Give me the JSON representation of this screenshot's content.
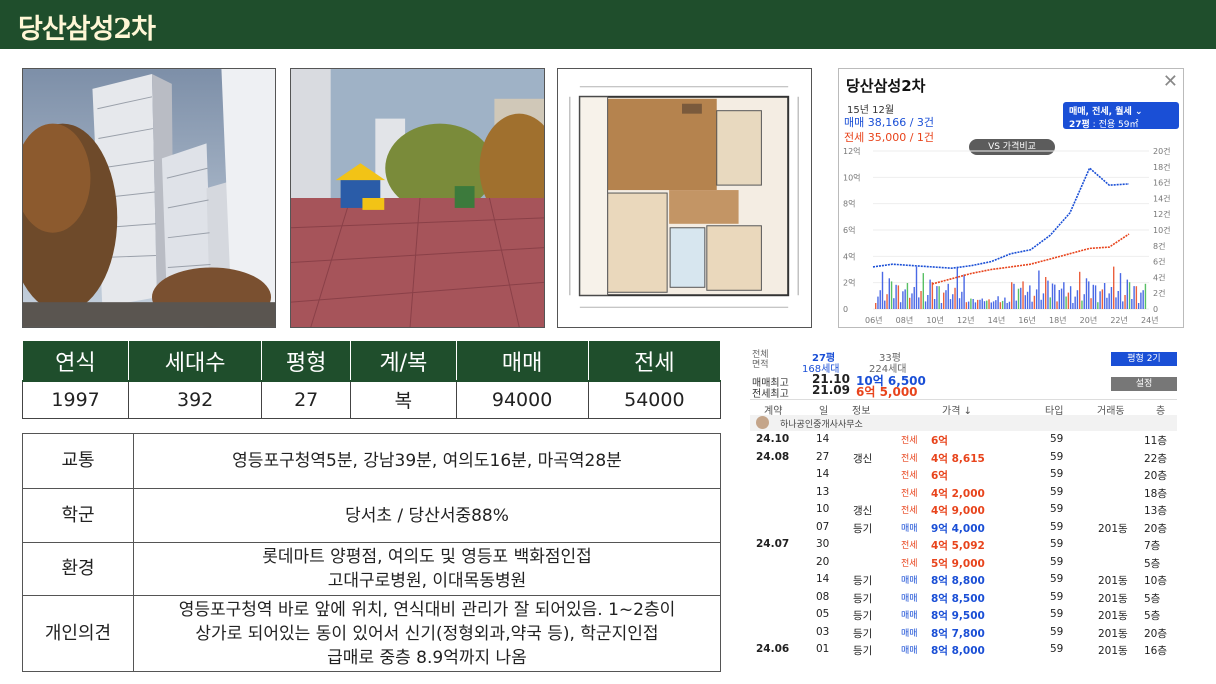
{
  "header": {
    "title": "당산삼성2차"
  },
  "basic": {
    "headers": [
      "연식",
      "세대수",
      "평형",
      "계/복",
      "매매",
      "전세"
    ],
    "values": [
      "1997",
      "392",
      "27",
      "복",
      "94000",
      "54000"
    ]
  },
  "details": [
    {
      "key": "교통",
      "lines": [
        "영등포구청역5분, 강남39분, 여의도16분, 마곡역28분"
      ]
    },
    {
      "key": "학군",
      "lines": [
        "당서초 / 당산서중88%"
      ]
    },
    {
      "key": "환경",
      "lines": [
        "롯데마트 양평점, 여의도 및 영등포 백화점인접",
        "고대구로병원, 이대목동병원"
      ]
    },
    {
      "key": "개인의견",
      "lines": [
        "영등포구청역 바로 앞에 위치, 연식대비 관리가 잘 되어있음. 1~2층이",
        "상가로 되어있는 동이 있어서 신기(정형외과,약국 등), 학군지인접",
        "급매로 중층 8.9억까지 나옴"
      ]
    }
  ],
  "chart": {
    "title": "당산삼성2차",
    "period": "15년 12월",
    "sale": "매매 38,166 / 3건",
    "rent": "전세 35,000 / 1건",
    "filter": "매매, 전세, 월세",
    "filter_size": "27평",
    "filter_sub": "전용 59㎡",
    "compare": "VS 가격비교",
    "colors": {
      "sale": "#1a4fd6",
      "rent": "#e8441c",
      "volume": "#2a4fe0",
      "green": "#3bb54a"
    }
  },
  "chart_data": {
    "type": "line",
    "x": [
      "06년",
      "08년",
      "10년",
      "12년",
      "14년",
      "16년",
      "18년",
      "20년",
      "22년",
      "24년"
    ],
    "y_left_ticks": [
      "12억",
      "10억",
      "8억",
      "6억",
      "4억",
      "2억",
      "0"
    ],
    "y_right_ticks": [
      "20건",
      "18건",
      "16건",
      "14건",
      "12건",
      "10건",
      "8건",
      "6건",
      "4건",
      "2건",
      "0"
    ],
    "series": [
      {
        "name": "매매",
        "values": [
          3.2,
          3.4,
          3.3,
          3.2,
          3.1,
          3.3,
          3.6,
          4.2,
          4.5,
          5.6,
          7.3,
          10.7,
          9.4,
          9.5
        ]
      },
      {
        "name": "전세",
        "values": [
          null,
          null,
          null,
          1.9,
          2.3,
          2.7,
          3.0,
          3.2,
          3.4,
          3.8,
          4.2,
          4.6,
          4.7,
          5.7
        ]
      }
    ],
    "ylim": [
      0,
      12
    ]
  },
  "tx": {
    "supply_label": "전체\n면적",
    "sizes": [
      "27평",
      "33평"
    ],
    "units": [
      "168세대",
      "224세대"
    ],
    "btn_size": "평형 2기",
    "max_sale_label": "매매최고",
    "max_sale_date": "21.10",
    "max_sale_price": "10억 6,500",
    "max_rent_label": "전세최고",
    "max_rent_date": "21.09",
    "max_rent_price": "6억 5,000",
    "btn_settings": "설정",
    "cols": [
      "계약",
      "일",
      "정보",
      "가격 ↓",
      "타입",
      "거래동",
      "층"
    ],
    "agent": "하나공인중개사사무소",
    "rows": [
      {
        "ym": "24.10",
        "d": "14",
        "tag": "",
        "type": "전세",
        "price": "6억",
        "area": "59",
        "dong": "",
        "fl": "11층",
        "kind": "rent"
      },
      {
        "ym": "24.08",
        "d": "27",
        "tag": "갱신",
        "type": "전세",
        "price": "4억 8,615",
        "area": "59",
        "dong": "",
        "fl": "22층",
        "kind": "rent"
      },
      {
        "ym": "",
        "d": "14",
        "tag": "",
        "type": "전세",
        "price": "6억",
        "area": "59",
        "dong": "",
        "fl": "20층",
        "kind": "rent"
      },
      {
        "ym": "",
        "d": "13",
        "tag": "",
        "type": "전세",
        "price": "4억 2,000",
        "area": "59",
        "dong": "",
        "fl": "18층",
        "kind": "rent"
      },
      {
        "ym": "",
        "d": "10",
        "tag": "갱신",
        "type": "전세",
        "price": "4억 9,000",
        "area": "59",
        "dong": "",
        "fl": "13층",
        "kind": "rent"
      },
      {
        "ym": "",
        "d": "07",
        "tag": "등기",
        "type": "매매",
        "price": "9억 4,000",
        "area": "59",
        "dong": "201동",
        "fl": "20층",
        "kind": "sale"
      },
      {
        "ym": "24.07",
        "d": "30",
        "tag": "",
        "type": "전세",
        "price": "4억 5,092",
        "area": "59",
        "dong": "",
        "fl": "7층",
        "kind": "rent"
      },
      {
        "ym": "",
        "d": "20",
        "tag": "",
        "type": "전세",
        "price": "5억 9,000",
        "area": "59",
        "dong": "",
        "fl": "5층",
        "kind": "rent"
      },
      {
        "ym": "",
        "d": "14",
        "tag": "등기",
        "type": "매매",
        "price": "8억 8,800",
        "area": "59",
        "dong": "201동",
        "fl": "10층",
        "kind": "sale"
      },
      {
        "ym": "",
        "d": "08",
        "tag": "등기",
        "type": "매매",
        "price": "8억 8,500",
        "area": "59",
        "dong": "201동",
        "fl": "5층",
        "kind": "sale"
      },
      {
        "ym": "",
        "d": "05",
        "tag": "등기",
        "type": "매매",
        "price": "8억 9,500",
        "area": "59",
        "dong": "201동",
        "fl": "5층",
        "kind": "sale"
      },
      {
        "ym": "",
        "d": "03",
        "tag": "등기",
        "type": "매매",
        "price": "8억 7,800",
        "area": "59",
        "dong": "201동",
        "fl": "20층",
        "kind": "sale"
      },
      {
        "ym": "24.06",
        "d": "01",
        "tag": "등기",
        "type": "매매",
        "price": "8억 8,000",
        "area": "59",
        "dong": "201동",
        "fl": "16층",
        "kind": "sale"
      }
    ]
  }
}
